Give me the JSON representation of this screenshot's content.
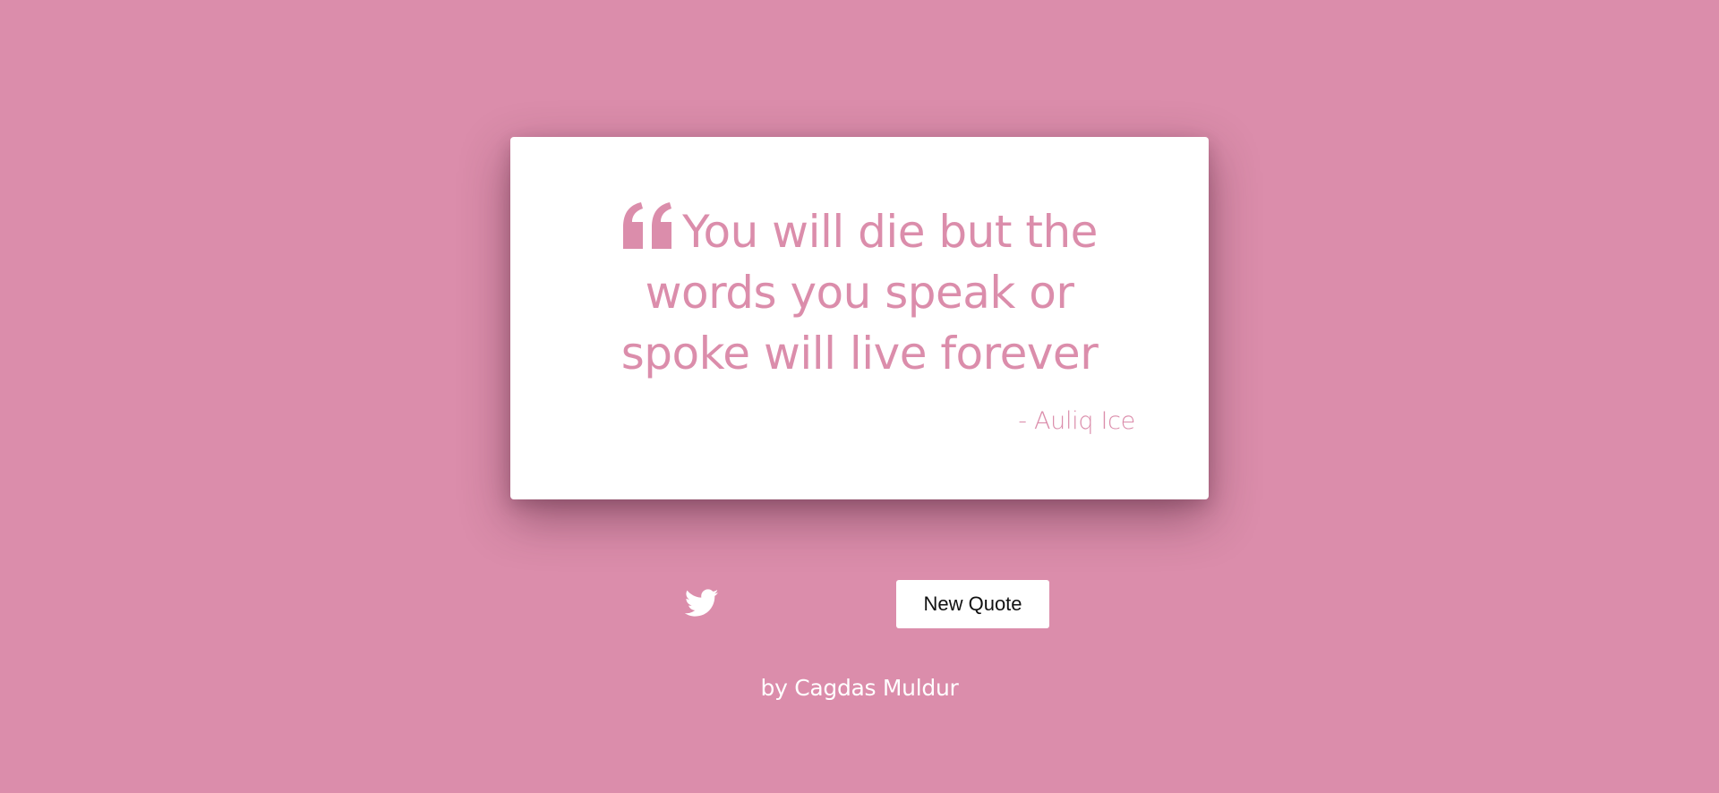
{
  "theme": {
    "background_color": "#db8dab",
    "card_color": "#ffffff",
    "accent_color": "#db8dab",
    "button_text_color": "#111111",
    "footer_text_color": "#ffffff"
  },
  "quote": {
    "icon": "quote-left-icon",
    "text": "You will die but the words you speak or spoke will live forever",
    "author": "- Auliq Ice"
  },
  "actions": {
    "tweet_icon": "twitter-icon",
    "new_quote_label": "New Quote"
  },
  "footer": {
    "credit": "by Cagdas Muldur"
  }
}
